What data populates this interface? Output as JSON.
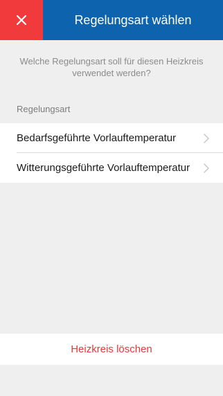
{
  "header": {
    "title": "Regelungsart wählen",
    "close_icon": "close-icon",
    "colors": {
      "bar": "#0d63ad",
      "close": "#f03a3c"
    }
  },
  "question": "Welche Regelungsart soll für diesen Heizkreis verwendet werden?",
  "section_label": "Regelungsart",
  "options": [
    {
      "label": "Bedarfsgeführte Vorlauftemperatur",
      "icon": "chevron-right-icon"
    },
    {
      "label": "Witterungsgeführte Vorlauftemperatur",
      "icon": "chevron-right-icon"
    }
  ],
  "delete_button": {
    "label": "Heizkreis löschen",
    "color": "#e63a3a"
  }
}
